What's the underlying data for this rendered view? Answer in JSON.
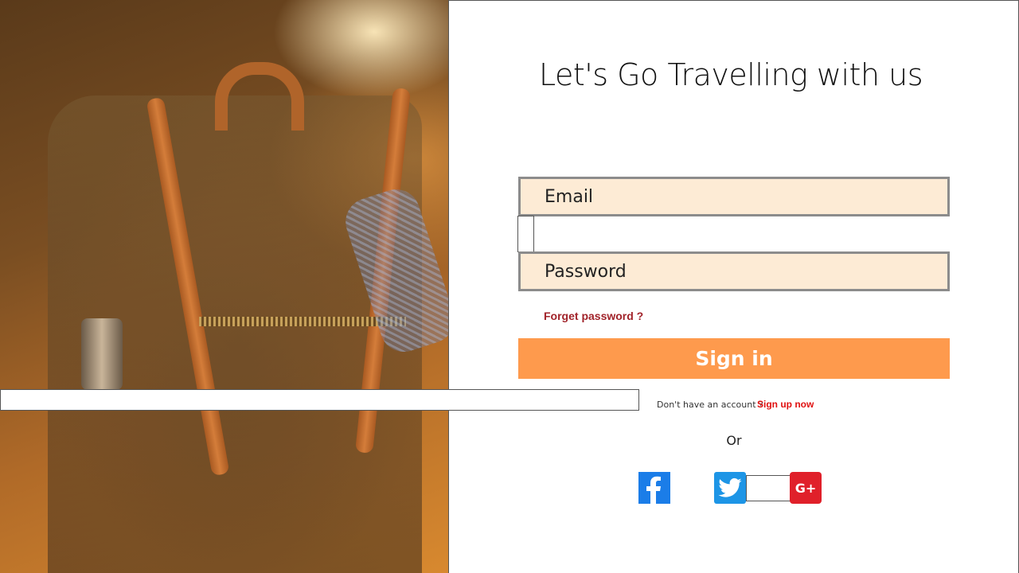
{
  "header": {
    "title": "Let's Go Travelling with us"
  },
  "form": {
    "email_placeholder": "Email",
    "password_placeholder": "Password",
    "forget_password": "Forget password ?",
    "sign_in": "Sign in"
  },
  "signup": {
    "prompt": "Don't have an account ?",
    "link": "Sign up now"
  },
  "alt": {
    "or": "Or"
  },
  "social": {
    "facebook_icon": "facebook-icon",
    "twitter_icon": "twitter-icon",
    "google_icon": "google-plus-icon",
    "google_label": "G+"
  },
  "colors": {
    "accent": "#fe9a4d",
    "field_bg": "#fdebd5",
    "forget_link": "#a1232a",
    "signup_link": "#e01010",
    "facebook": "#1b7de8",
    "twitter": "#1d95e6",
    "google": "#e0202a"
  }
}
